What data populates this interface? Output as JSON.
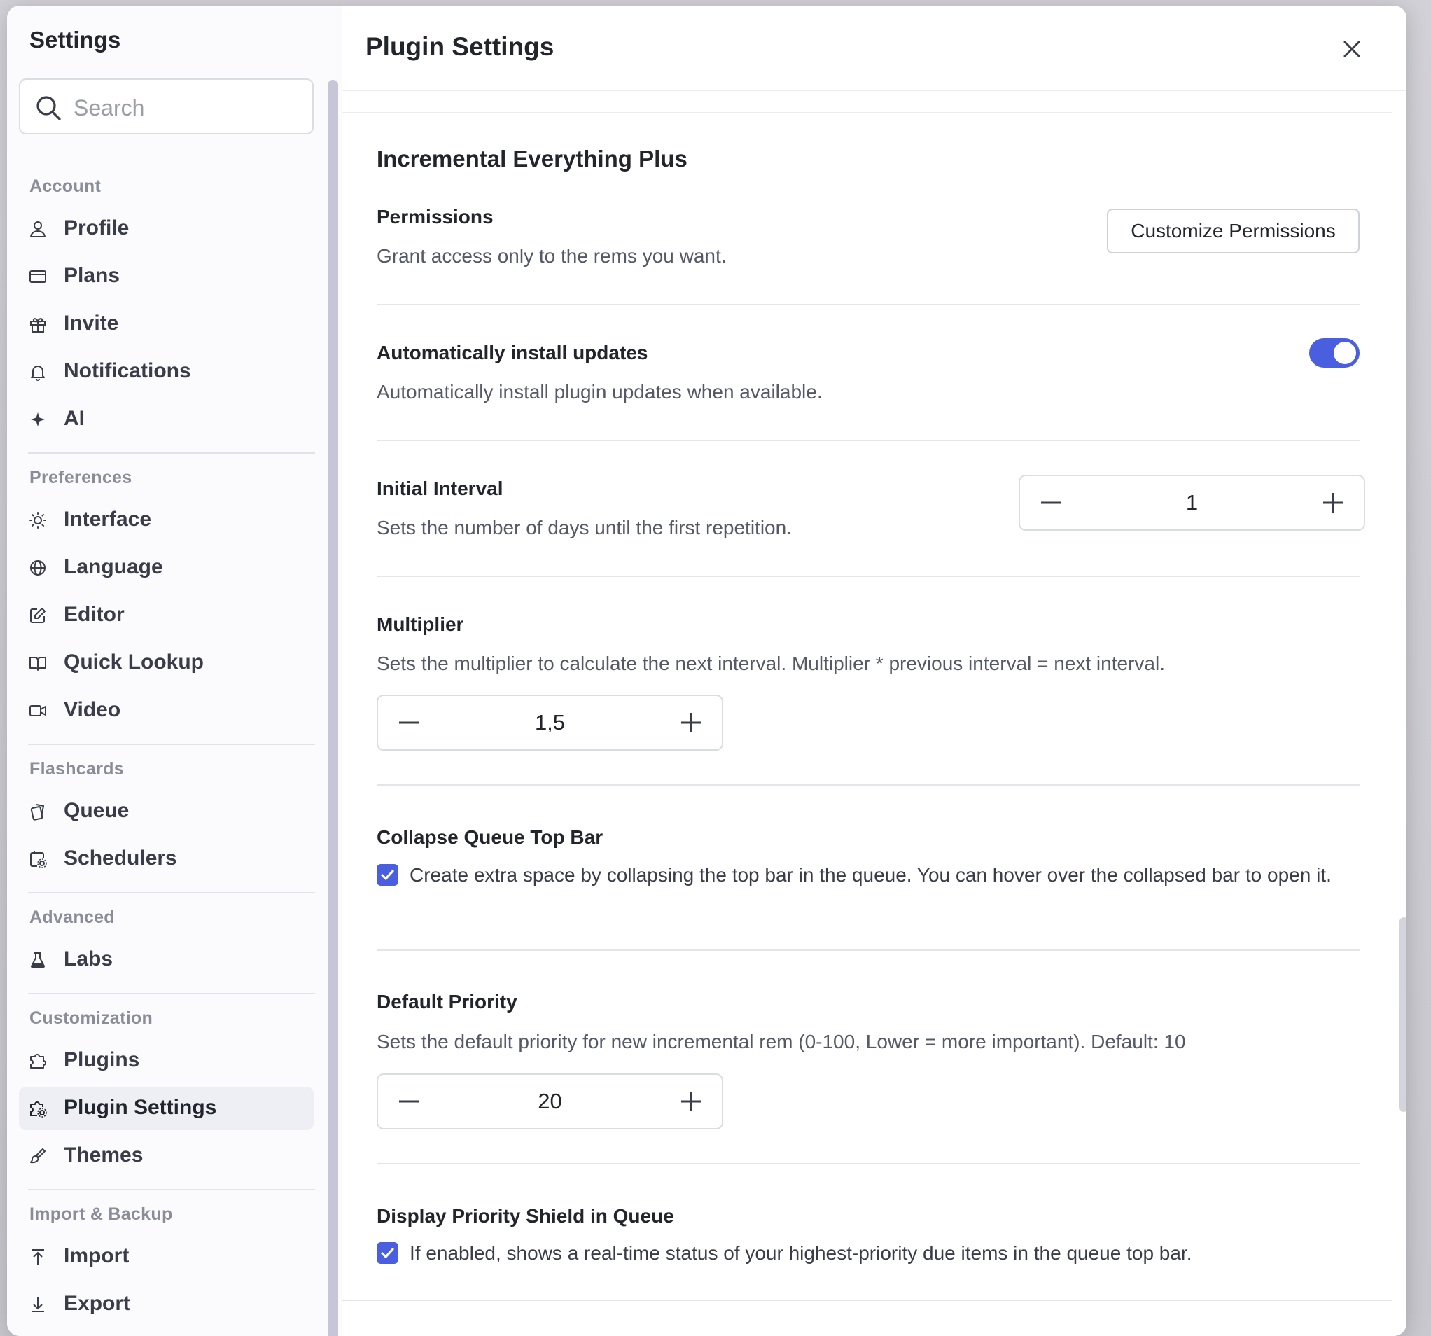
{
  "sidebar": {
    "title": "Settings",
    "search_placeholder": "Search",
    "sections": [
      {
        "header": "Account",
        "items": [
          {
            "label": "Profile",
            "icon": "user-icon"
          },
          {
            "label": "Plans",
            "icon": "credit-card-icon"
          },
          {
            "label": "Invite",
            "icon": "gift-icon"
          },
          {
            "label": "Notifications",
            "icon": "bell-icon"
          },
          {
            "label": "AI",
            "icon": "sparkle-icon"
          }
        ]
      },
      {
        "header": "Preferences",
        "items": [
          {
            "label": "Interface",
            "icon": "sun-icon"
          },
          {
            "label": "Language",
            "icon": "globe-icon"
          },
          {
            "label": "Editor",
            "icon": "edit-icon"
          },
          {
            "label": "Quick Lookup",
            "icon": "book-icon"
          },
          {
            "label": "Video",
            "icon": "video-icon"
          }
        ]
      },
      {
        "header": "Flashcards",
        "items": [
          {
            "label": "Queue",
            "icon": "cards-icon"
          },
          {
            "label": "Schedulers",
            "icon": "calendar-gear-icon"
          }
        ]
      },
      {
        "header": "Advanced",
        "items": [
          {
            "label": "Labs",
            "icon": "flask-icon"
          }
        ]
      },
      {
        "header": "Customization",
        "items": [
          {
            "label": "Plugins",
            "icon": "plugin-icon"
          },
          {
            "label": "Plugin Settings",
            "icon": "plugin-gear-icon",
            "active": true
          },
          {
            "label": "Themes",
            "icon": "brush-icon"
          }
        ]
      },
      {
        "header": "Import & Backup",
        "items": [
          {
            "label": "Import",
            "icon": "upload-icon"
          },
          {
            "label": "Export",
            "icon": "download-icon"
          }
        ]
      }
    ]
  },
  "main": {
    "title": "Plugin Settings",
    "plugin_name": "Incremental Everything Plus",
    "permissions": {
      "title": "Permissions",
      "description": "Grant access only to the rems you want.",
      "button_label": "Customize Permissions"
    },
    "auto_update": {
      "title": "Automatically install updates",
      "description": "Automatically install plugin updates when available.",
      "enabled": true
    },
    "initial_interval": {
      "title": "Initial Interval",
      "description": "Sets the number of days until the first repetition.",
      "value": "1"
    },
    "multiplier": {
      "title": "Multiplier",
      "description": "Sets the multiplier to calculate the next interval. Multiplier * previous interval = next interval.",
      "value": "1,5"
    },
    "collapse_queue": {
      "title": "Collapse Queue Top Bar",
      "description": "Create extra space by collapsing the top bar in the queue. You can hover over the collapsed bar to open it.",
      "checked": true
    },
    "default_priority": {
      "title": "Default Priority",
      "description": "Sets the default priority for new incremental rem (0-100, Lower = more important). Default: 10",
      "value": "20"
    },
    "priority_shield": {
      "title": "Display Priority Shield in Queue",
      "description": "If enabled, shows a real-time status of your highest-priority due items in the queue top bar.",
      "checked": true
    }
  },
  "colors": {
    "accent": "#4a5ee0",
    "active_nav_bg": "#eeeff5",
    "text_primary": "#23252c",
    "text_secondary": "#555866"
  }
}
